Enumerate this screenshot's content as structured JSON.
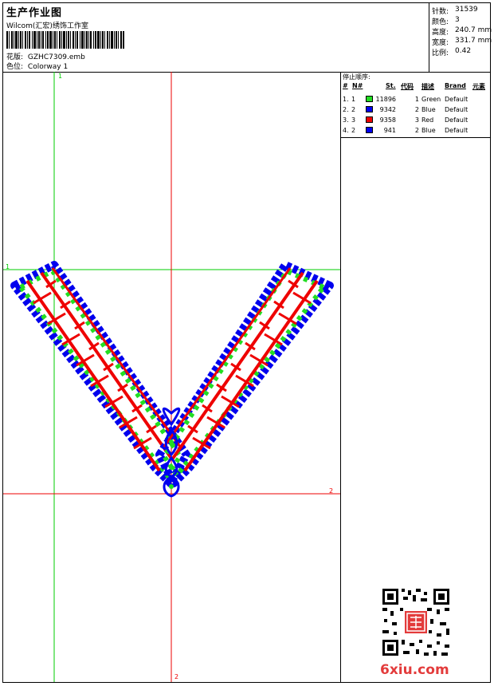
{
  "header": {
    "title": "生产作业图",
    "studio": "Wilcom(汇宏)绣饰工作室",
    "design_label": "花版:",
    "design_value": "GZHC7309.emb",
    "color_label": "色位:",
    "color_value": "Colorway 1"
  },
  "stats": [
    {
      "label": "针数:",
      "value": "31539"
    },
    {
      "label": "颜色:",
      "value": "3"
    },
    {
      "label": "高度:",
      "value": "240.7 mm"
    },
    {
      "label": "宽度:",
      "value": "331.7 mm"
    },
    {
      "label": "比例:",
      "value": "0.42"
    }
  ],
  "stop_sequence": {
    "title": "停止顺序:",
    "headers": [
      "#",
      "N#",
      "St.",
      "代码",
      "描述",
      "Brand",
      "元素"
    ],
    "rows": [
      {
        "num": "1.",
        "n": "1",
        "color": "#22dd22",
        "st": "11896",
        "code": "1",
        "desc": "Green",
        "brand": "Default"
      },
      {
        "num": "2.",
        "n": "2",
        "color": "#0000ee",
        "st": "9342",
        "code": "2",
        "desc": "Blue",
        "brand": "Default"
      },
      {
        "num": "3.",
        "n": "3",
        "color": "#ee0000",
        "st": "9358",
        "code": "3",
        "desc": "Red",
        "brand": "Default"
      },
      {
        "num": "4.",
        "n": "2",
        "color": "#0000ee",
        "st": "941",
        "code": "2",
        "desc": "Blue",
        "brand": "Default"
      }
    ]
  },
  "axis_labels": {
    "v1": "1",
    "h1": "1",
    "h2": "2",
    "v2": "2"
  },
  "colors": {
    "green_guide": "#00cc00",
    "red_guide": "#ee0000",
    "border": "#000000"
  },
  "watermark": {
    "site": "6xiu.com"
  }
}
